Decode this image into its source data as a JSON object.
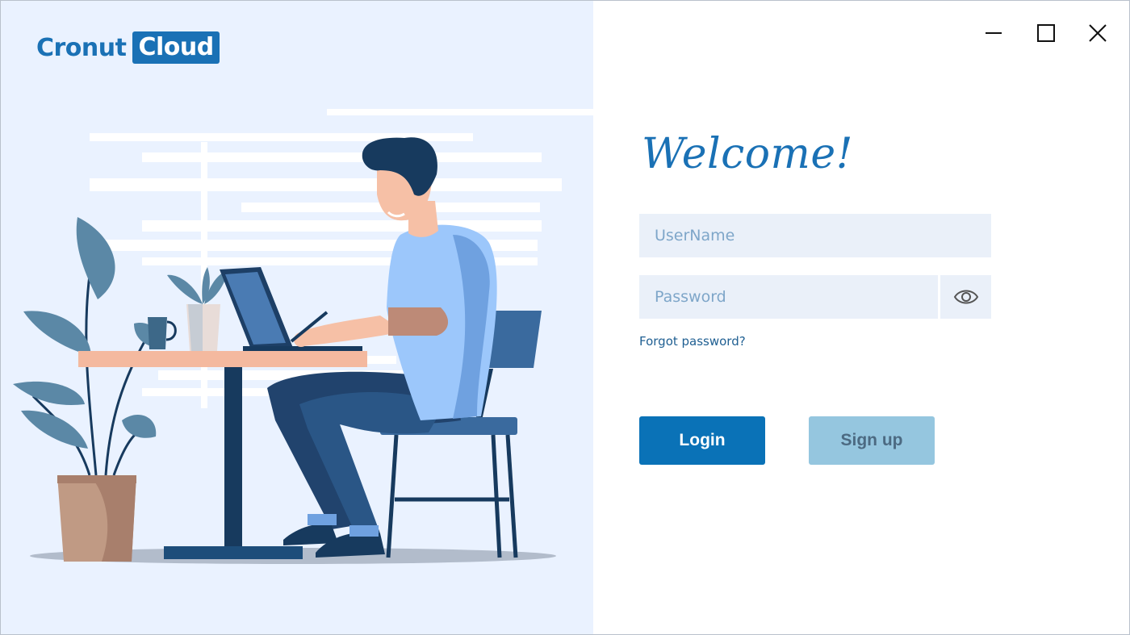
{
  "brand": {
    "part1": "Cronut",
    "part2": "Cloud"
  },
  "window_controls": {
    "minimize_icon": "minimize-icon",
    "maximize_icon": "maximize-icon",
    "close_icon": "close-icon"
  },
  "login": {
    "heading": "Welcome!",
    "username_placeholder": "UserName",
    "password_placeholder": "Password",
    "show_password_icon": "eye-icon",
    "forgot_password": "Forgot password?",
    "login_label": "Login",
    "signup_label": "Sign up"
  },
  "colors": {
    "brand_blue": "#1a71b5",
    "left_panel_bg": "#eaf2ff",
    "field_bg": "#eaf0f9",
    "login_button": "#0a72b7",
    "signup_button": "#95c6df"
  }
}
